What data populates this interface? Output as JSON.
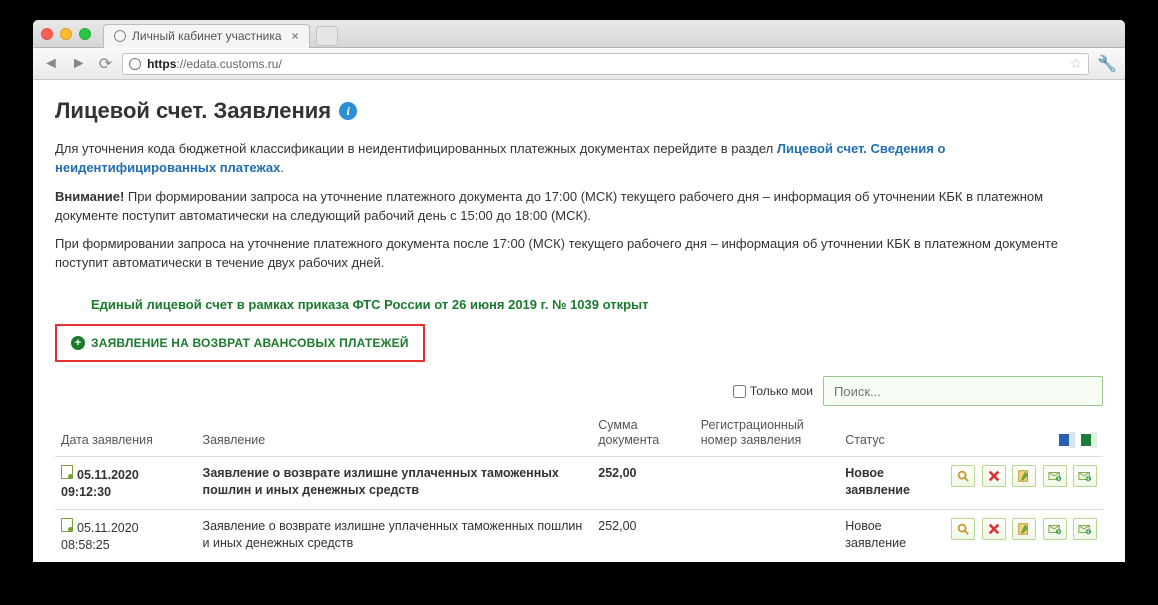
{
  "browser": {
    "tab_title": "Личный кабинет участника",
    "url_https": "https",
    "url_rest": "://edata.customs.ru/"
  },
  "page": {
    "title": "Лицевой счет. Заявления",
    "lead1_prefix": "Для уточнения кода бюджетной классификации в неидентифицированных платежных документах перейдите в раздел ",
    "lead1_link": "Лицевой счет. Сведения о неидентифицированных платежах",
    "lead1_suffix": ".",
    "lead2_strong": "Внимание!",
    "lead2_rest": " При формировании запроса на уточнение платежного документа до 17:00 (МСК) текущего рабочего дня – информация об уточнении КБК в платежном документе поступит автоматически на следующий рабочий день с 15:00 до 18:00 (МСК).",
    "lead3": "При формировании запроса на уточнение платежного документа после 17:00 (МСК) текущего рабочего дня – информация об уточнении КБК в платежном документе поступит автоматически в течение двух рабочих дней.",
    "banner": "Единый лицевой счет в рамках приказа ФТС России от 26 июня 2019 г. № 1039 открыт",
    "add_button": "ЗАЯВЛЕНИЕ НА ВОЗВРАТ АВАНСОВЫХ ПЛАТЕЖЕЙ",
    "only_mine": "Только мои",
    "search_placeholder": "Поиск..."
  },
  "table": {
    "headers": {
      "date": "Дата заявления",
      "title": "Заявление",
      "amount": "Сумма документа",
      "regnum": "Регистрационный номер заявления",
      "status": "Статус"
    },
    "rows": [
      {
        "date": "05.11.2020 09:12:30",
        "title": "Заявление о возврате излишне уплаченных таможенных пошлин и иных денежных средств",
        "amount": "252,00",
        "regnum": "",
        "status": "Новое заявление"
      },
      {
        "date": "05.11.2020 08:58:25",
        "title": "Заявление о возврате излишне уплаченных таможенных пошлин и иных денежных средств",
        "amount": "252,00",
        "regnum": "",
        "status": "Новое заявление"
      }
    ]
  }
}
